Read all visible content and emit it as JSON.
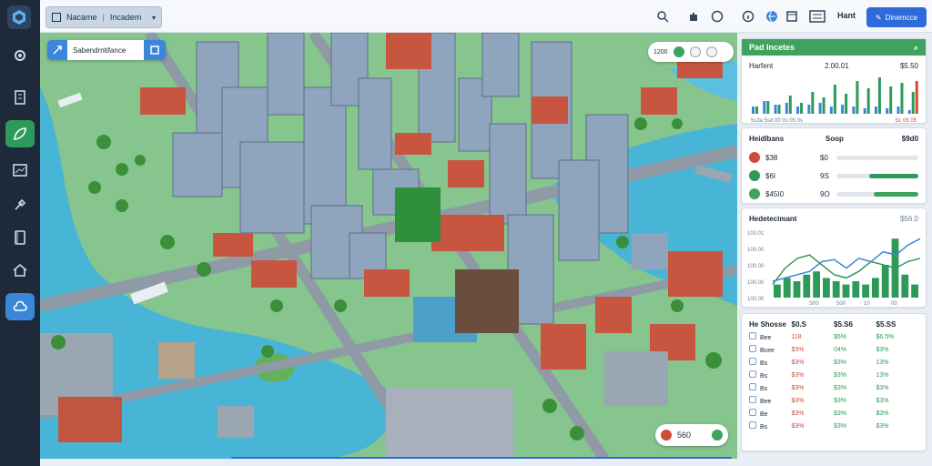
{
  "app": {
    "tabs": [
      "Nacame",
      "Incadem"
    ]
  },
  "sidebar": {
    "items": [
      {
        "icon": "gear-icon"
      },
      {
        "icon": "building-icon"
      },
      {
        "icon": "leaf-icon",
        "active": true
      },
      {
        "icon": "chart-icon"
      },
      {
        "icon": "tools-icon"
      },
      {
        "icon": "book-icon"
      },
      {
        "icon": "home-icon"
      },
      {
        "icon": "cloud-icon",
        "active_blue": true
      }
    ]
  },
  "topbar": {
    "icons": [
      "search-icon",
      "puzzle-icon",
      "circle-icon",
      "info-icon",
      "globe-icon",
      "window-icon"
    ],
    "user_label": "Hant",
    "action_label": "Dinemcce"
  },
  "map": {
    "search_text": "Sabendrntifance",
    "controls_value": "1200",
    "money_value": "560"
  },
  "panels": {
    "finance": {
      "title": "Pad Incetes",
      "label": "Harfent",
      "value1": "2.00.01",
      "value2": "$5.50",
      "bars_green": [
        0.2,
        0.35,
        0.25,
        0.5,
        0.3,
        0.6,
        0.45,
        0.8,
        0.55,
        0.9,
        0.7,
        1.0,
        0.75,
        0.85,
        0.6
      ],
      "bars_red": [
        0.0,
        0.0,
        0.0,
        0.0,
        0.0,
        0.0,
        0.0,
        0.0,
        0.0,
        0.0,
        0.0,
        0.0,
        0.0,
        0.0,
        0.9
      ],
      "bars_blue": [
        0.2,
        0.35,
        0.25,
        0.3,
        0.2,
        0.25,
        0.3,
        0.2,
        0.25,
        0.2,
        0.15,
        0.2,
        0.15,
        0.2,
        0.1
      ],
      "footer_left": "5s3a 5sd 00 0s 05 0s",
      "footer_right": "51 05 05"
    },
    "resources": {
      "title": "Heidlbans",
      "title2": "Soop",
      "value_top": "$9d0",
      "rows": [
        {
          "icon": "gem-icon",
          "label": "$38",
          "value": "$0",
          "color": "#d04a3a",
          "fill": 0
        },
        {
          "icon": "badge-icon",
          "label": "$6I",
          "value": "9S",
          "color": "#2d9a5a",
          "fill": 0.6
        },
        {
          "icon": "coin-icon",
          "label": "$45I0",
          "value": "9O",
          "color": "#3fa35e",
          "fill": 0.55
        }
      ]
    },
    "stats": {
      "title": "Hedetecimant",
      "value": "$56.0",
      "ylabels": [
        "100.01",
        "100.00",
        "100.00",
        "100.00",
        "100.00"
      ],
      "xlabels": [
        "S00",
        "500",
        "10",
        "00"
      ],
      "line_green": [
        20,
        45,
        60,
        65,
        50,
        35,
        30,
        40,
        55,
        50,
        45,
        55,
        60
      ],
      "line_blue": [
        25,
        30,
        35,
        40,
        55,
        58,
        45,
        60,
        55,
        70,
        65,
        80,
        90
      ],
      "bars": [
        0.2,
        0.3,
        0.25,
        0.35,
        0.4,
        0.3,
        0.25,
        0.2,
        0.25,
        0.2,
        0.3,
        0.5,
        0.9,
        0.35,
        0.2
      ]
    },
    "table": {
      "title": "He Shosse",
      "headers": [
        "$0.S",
        "$5.S6",
        "$5.SS"
      ],
      "rows": [
        {
          "c0": "Bee",
          "c1": "118",
          "c2": "$5%",
          "c3": "$6.5%"
        },
        {
          "c0": "Bcee",
          "c1": "$3%",
          "c2": "04%",
          "c3": "$3%"
        },
        {
          "c0": "Bs",
          "c1": "$3%",
          "c2": "$3%",
          "c3": "13%"
        },
        {
          "c0": "Bs",
          "c1": "$3%",
          "c2": "$3%",
          "c3": "13%"
        },
        {
          "c0": "Bs",
          "c1": "$3%",
          "c2": "$3%",
          "c3": "$3%"
        },
        {
          "c0": "Bee",
          "c1": "$3%",
          "c2": "$3%",
          "c3": "$3%"
        },
        {
          "c0": "Be",
          "c1": "$3%",
          "c2": "$3%",
          "c3": "$3%"
        },
        {
          "c0": "Bs",
          "c1": "$3%",
          "c2": "$3%",
          "c3": "$3%"
        }
      ]
    }
  }
}
